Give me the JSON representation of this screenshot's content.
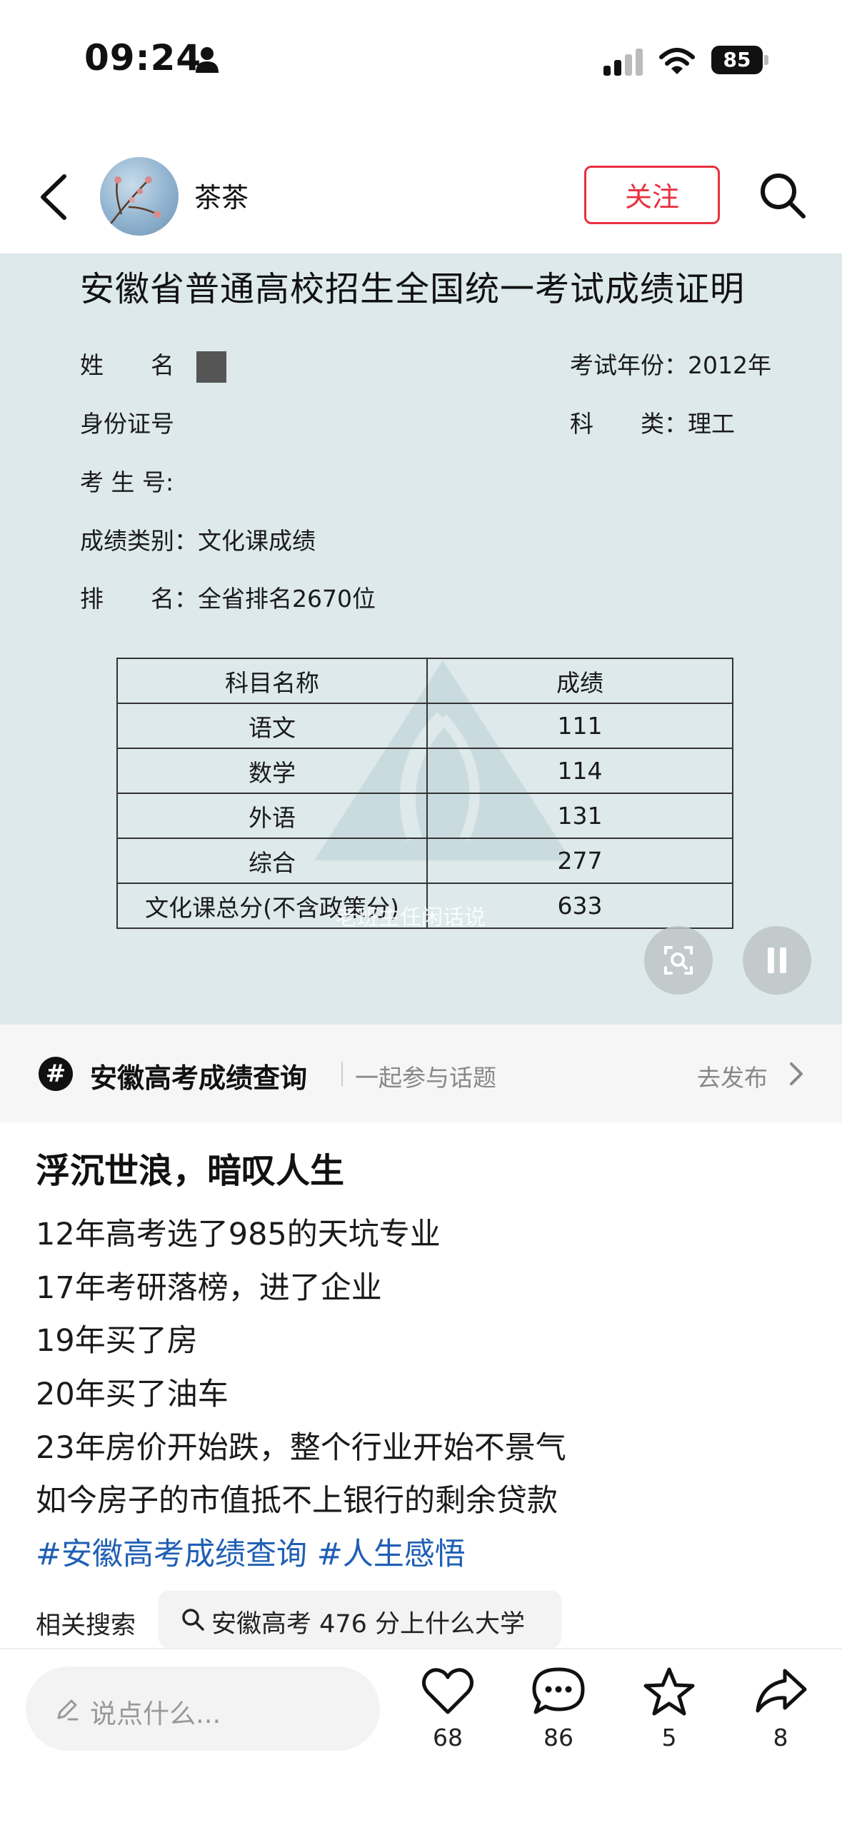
{
  "status_bar": {
    "time": "09:24",
    "battery": "85"
  },
  "header": {
    "username": "茶茶",
    "follow_label": "关注"
  },
  "document": {
    "title": "安徽省普通高校招生全国统一考试成绩证明",
    "name_label": "姓　　名",
    "id_label": "身份证号",
    "exam_no_label": "考 生 号:",
    "score_type": "成绩类别：文化课成绩",
    "rank": "排　　名：全省排名2670位",
    "exam_year": "考试年份：2012年",
    "subject_type": "科　　类：理工",
    "table": {
      "headers": [
        "科目名称",
        "成绩"
      ],
      "rows": [
        [
          "语文",
          "111"
        ],
        [
          "数学",
          "114"
        ],
        [
          "外语",
          "131"
        ],
        [
          "综合",
          "277"
        ],
        [
          "文化课总分(不含政策分)",
          "633"
        ]
      ]
    },
    "watermark_text": "老班主任闲话说"
  },
  "topic": {
    "name": "安徽高考成绩查询",
    "join": "一起参与话题",
    "post": "去发布"
  },
  "post": {
    "title": "浮沉世浪，暗叹人生",
    "lines": [
      "12年高考选了985的天坑专业",
      "17年考研落榜，进了企业",
      "19年买了房",
      "20年买了油车",
      "23年房价开始跌，整个行业开始不景气",
      "如今房子的市值抵不上银行的剩余贷款"
    ],
    "tags": "#安徽高考成绩查询 #人生感悟"
  },
  "related": {
    "label": "相关搜索",
    "query": "安徽高考 476 分上什么大学"
  },
  "bottom_bar": {
    "comment_placeholder": "说点什么...",
    "likes": "68",
    "comments": "86",
    "favorites": "5",
    "shares": "8"
  }
}
